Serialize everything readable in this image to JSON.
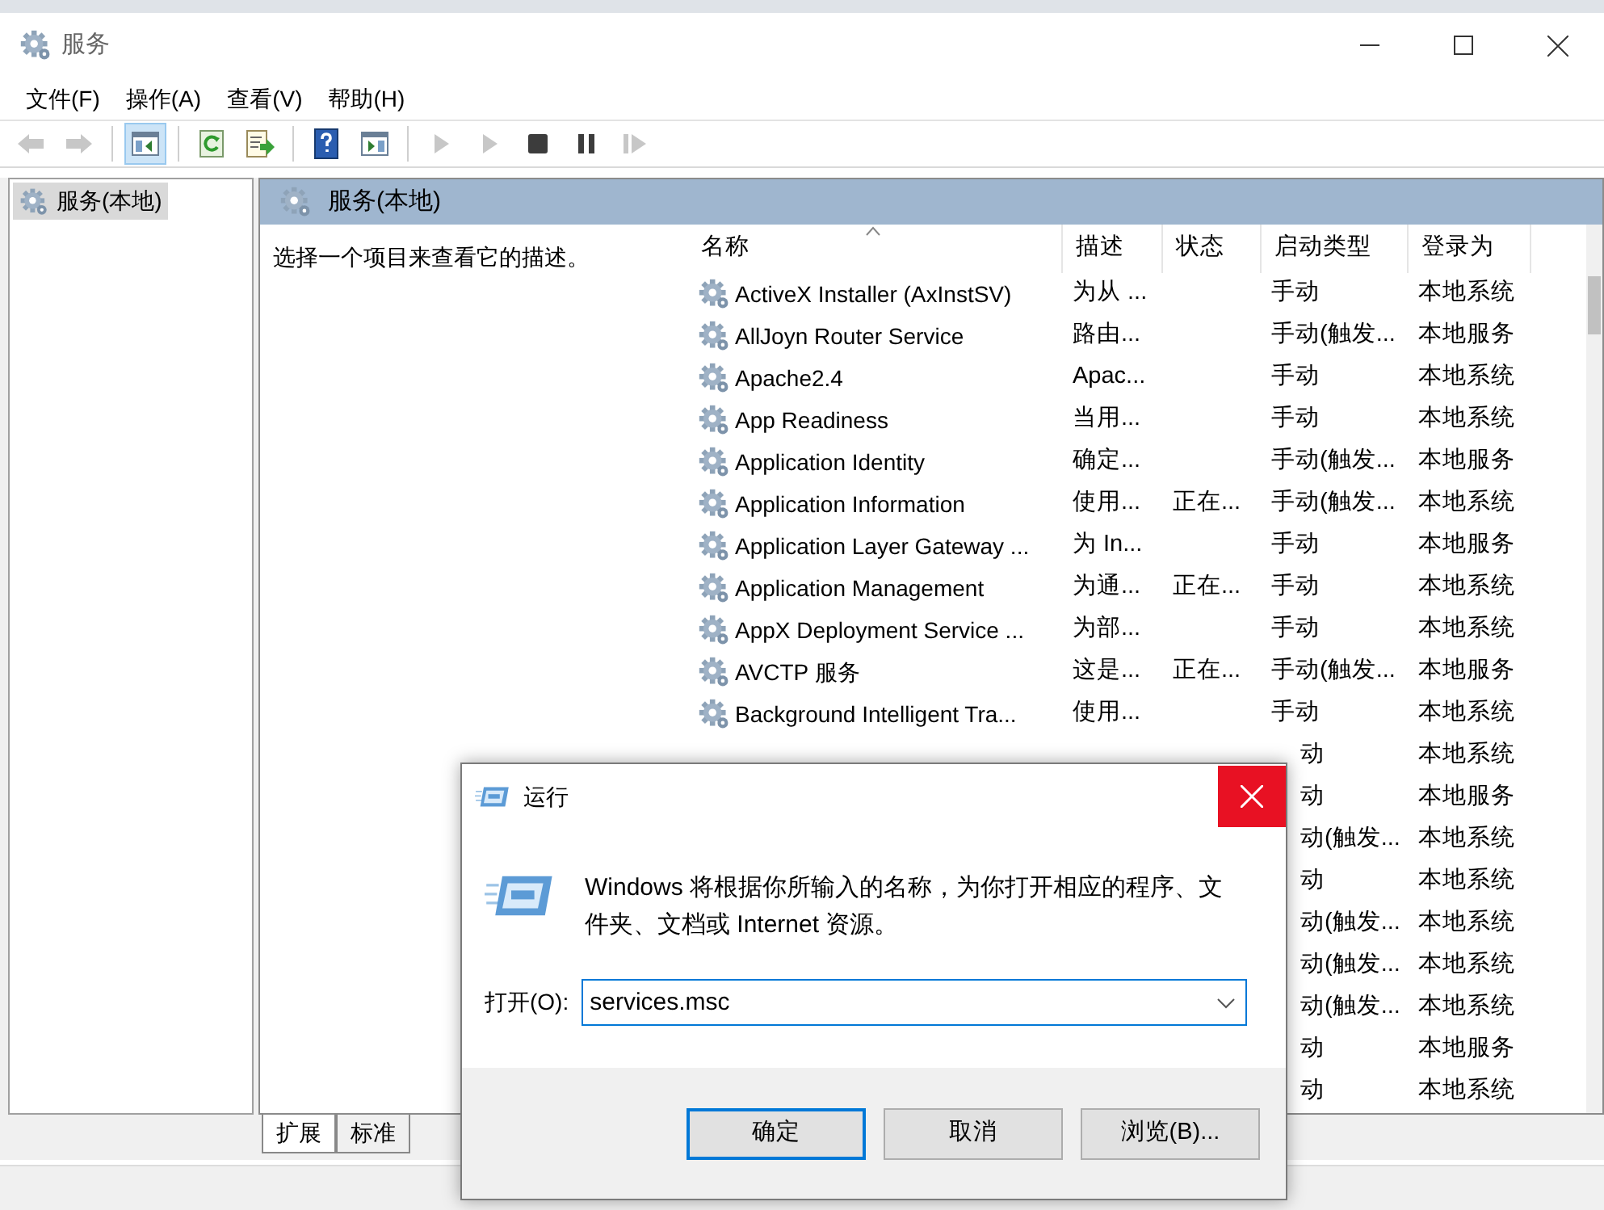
{
  "window": {
    "title": "服务"
  },
  "menu": [
    "文件(F)",
    "操作(A)",
    "查看(V)",
    "帮助(H)"
  ],
  "toolbar": [
    [
      {
        "kind": "back",
        "selected": false,
        "disabled": true
      },
      {
        "kind": "forward",
        "selected": false,
        "disabled": true
      }
    ],
    [
      {
        "kind": "tree",
        "selected": true,
        "disabled": false
      }
    ],
    [
      {
        "kind": "refresh",
        "selected": false,
        "disabled": false
      },
      {
        "kind": "export",
        "selected": false,
        "disabled": false
      }
    ],
    [
      {
        "kind": "help",
        "selected": false,
        "disabled": false
      },
      {
        "kind": "view",
        "selected": false,
        "disabled": false
      }
    ],
    [
      {
        "kind": "start",
        "selected": false,
        "disabled": true
      },
      {
        "kind": "start",
        "selected": false,
        "disabled": true
      },
      {
        "kind": "stop",
        "selected": false,
        "disabled": false
      },
      {
        "kind": "pause",
        "selected": false,
        "disabled": false
      },
      {
        "kind": "resume",
        "selected": false,
        "disabled": true
      }
    ]
  ],
  "tree": [
    {
      "label": "服务(本地)",
      "selected": true
    }
  ],
  "pane_title": "服务(本地)",
  "description": "选择一个项目来查看它的描述。",
  "columns": [
    {
      "label": "名称",
      "sorted": true
    },
    {
      "label": "描述",
      "sorted": false
    },
    {
      "label": "状态",
      "sorted": false
    },
    {
      "label": "启动类型",
      "sorted": false
    },
    {
      "label": "登录为",
      "sorted": false
    }
  ],
  "rows": [
    {
      "name": "ActiveX Installer (AxInstSV)",
      "description": "为从 ...",
      "startup": "手动",
      "logon": "本地系统"
    },
    {
      "name": "AllJoyn Router Service",
      "description": "路由...",
      "startup": "手动(触发...",
      "logon": "本地服务"
    },
    {
      "name": "Apache2.4",
      "description": "Apac...",
      "startup": "手动",
      "logon": "本地系统"
    },
    {
      "name": "App Readiness",
      "description": "当用...",
      "startup": "手动",
      "logon": "本地系统"
    },
    {
      "name": "Application Identity",
      "description": "确定...",
      "startup": "手动(触发...",
      "logon": "本地服务"
    },
    {
      "name": "Application Information",
      "description": "使用...",
      "status": "正在...",
      "startup": "手动(触发...",
      "logon": "本地系统"
    },
    {
      "name": "Application Layer Gateway ...",
      "description": "为 In...",
      "startup": "手动",
      "logon": "本地服务"
    },
    {
      "name": "Application Management",
      "description": "为通...",
      "status": "正在...",
      "startup": "手动",
      "logon": "本地系统"
    },
    {
      "name": "AppX Deployment Service ...",
      "description": "为部...",
      "startup": "手动",
      "logon": "本地系统"
    },
    {
      "name": "AVCTP 服务",
      "description": "这是...",
      "status": "正在...",
      "startup": "手动(触发...",
      "logon": "本地服务"
    },
    {
      "name": "Background Intelligent Tra...",
      "description": "使用...",
      "startup": "手动",
      "logon": "本地系统"
    },
    {
      "startup": "动",
      "logon": "本地系统"
    },
    {
      "startup": "动",
      "logon": "本地服务"
    },
    {
      "startup": "动(触发...",
      "logon": "本地系统"
    },
    {
      "startup": "动",
      "logon": "本地系统"
    },
    {
      "startup": "动(触发...",
      "logon": "本地系统"
    },
    {
      "startup": "动(触发...",
      "logon": "本地系统"
    },
    {
      "startup": "动(触发...",
      "logon": "本地系统"
    },
    {
      "startup": "动",
      "logon": "本地服务"
    },
    {
      "startup": "动",
      "logon": "本地系统"
    }
  ],
  "tabs": [
    {
      "label": "扩展",
      "selected": true
    },
    {
      "label": "标准",
      "selected": false
    }
  ],
  "dialog": {
    "title": "运行",
    "message": "Windows 将根据你所输入的名称，为你打开相应的程序、文件夹、文档或 Internet 资源。",
    "open_label": "打开(O):",
    "value": "services.msc",
    "buttons": [
      {
        "label": "确定",
        "default": true
      },
      {
        "label": "取消",
        "default": false
      },
      {
        "label": "浏览(B)...",
        "default": false
      }
    ]
  }
}
